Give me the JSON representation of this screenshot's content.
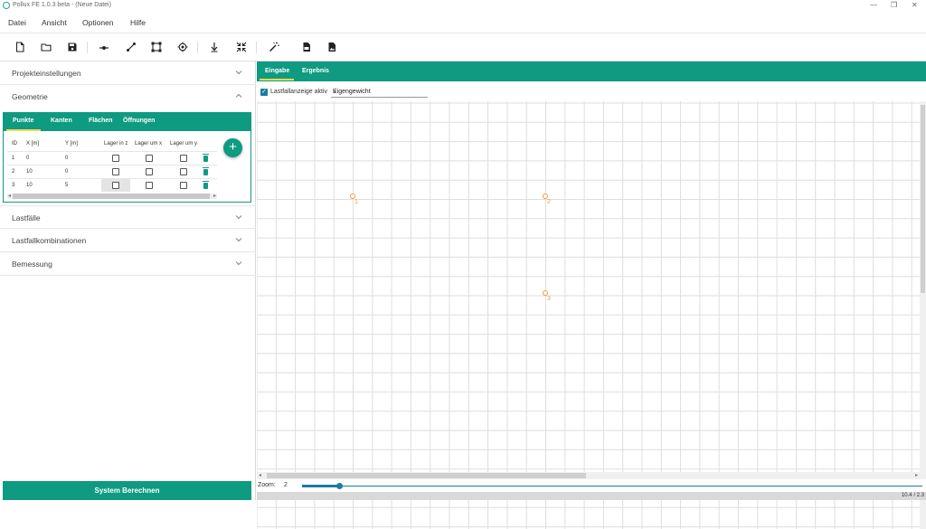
{
  "window": {
    "title": "Pollux FE 1.0.3 beta - (Neue Datei)",
    "controls": [
      "—",
      "❐",
      "✕"
    ]
  },
  "menu": [
    "Datei",
    "Ansicht",
    "Optionen",
    "Hilfe"
  ],
  "toolbar": {
    "icons": [
      "new-file-icon",
      "open-folder-icon",
      "save-icon",
      "add-point-icon",
      "add-edge-icon",
      "add-area-icon",
      "target-icon",
      "load-arrow-icon",
      "compress-icon",
      "magic-wand-icon",
      "export-pdf-icon",
      "export-image-icon"
    ]
  },
  "sidebar": {
    "sections": [
      {
        "label": "Projekteinstellungen",
        "expanded": false
      },
      {
        "label": "Geometrie",
        "expanded": true
      },
      {
        "label": "Lastfälle",
        "expanded": false
      },
      {
        "label": "Lastfallkombinationen",
        "expanded": false
      },
      {
        "label": "Bemessung",
        "expanded": false
      }
    ],
    "geometry_tabs": [
      "Punkte",
      "Kanten",
      "Flächen",
      "Öffnungen"
    ],
    "active_geometry_tab": "Punkte",
    "points_table": {
      "columns": [
        "ID",
        "X [m]",
        "Y [m]",
        "Lager in z",
        "Lager um x",
        "Lager um y"
      ],
      "rows": [
        {
          "id": "1",
          "x": "0",
          "y": "0",
          "lz": false,
          "lx": false,
          "ly": false
        },
        {
          "id": "2",
          "x": "10",
          "y": "0",
          "lz": false,
          "lx": false,
          "ly": false
        },
        {
          "id": "3",
          "x": "10",
          "y": "5",
          "lz": false,
          "lx": false,
          "ly": false
        }
      ]
    },
    "add_button": "+",
    "calculate_button": "System Berechnen"
  },
  "main": {
    "tabs": [
      "Eingabe",
      "Ergebnis"
    ],
    "active_tab": "Eingabe",
    "loadcase_toggle_label": "Lastfallanzeige aktiv",
    "loadcase_toggle_checked": true,
    "loadcase_selected": "Eigengewicht",
    "nodes": [
      {
        "label": "1",
        "x": 0,
        "y": 0
      },
      {
        "label": "2",
        "x": 10,
        "y": 0
      },
      {
        "label": "3",
        "x": 10,
        "y": 5
      }
    ],
    "zoom_label": "Zoom:",
    "zoom_value": "2",
    "zoom_fraction": 0.06,
    "coords": "10.4 / 2.3",
    "colors": {
      "accent": "#0f9a82",
      "tab_indicator": "#ffd84d",
      "node": "#f09830",
      "slider": "#1a7c9e"
    }
  }
}
